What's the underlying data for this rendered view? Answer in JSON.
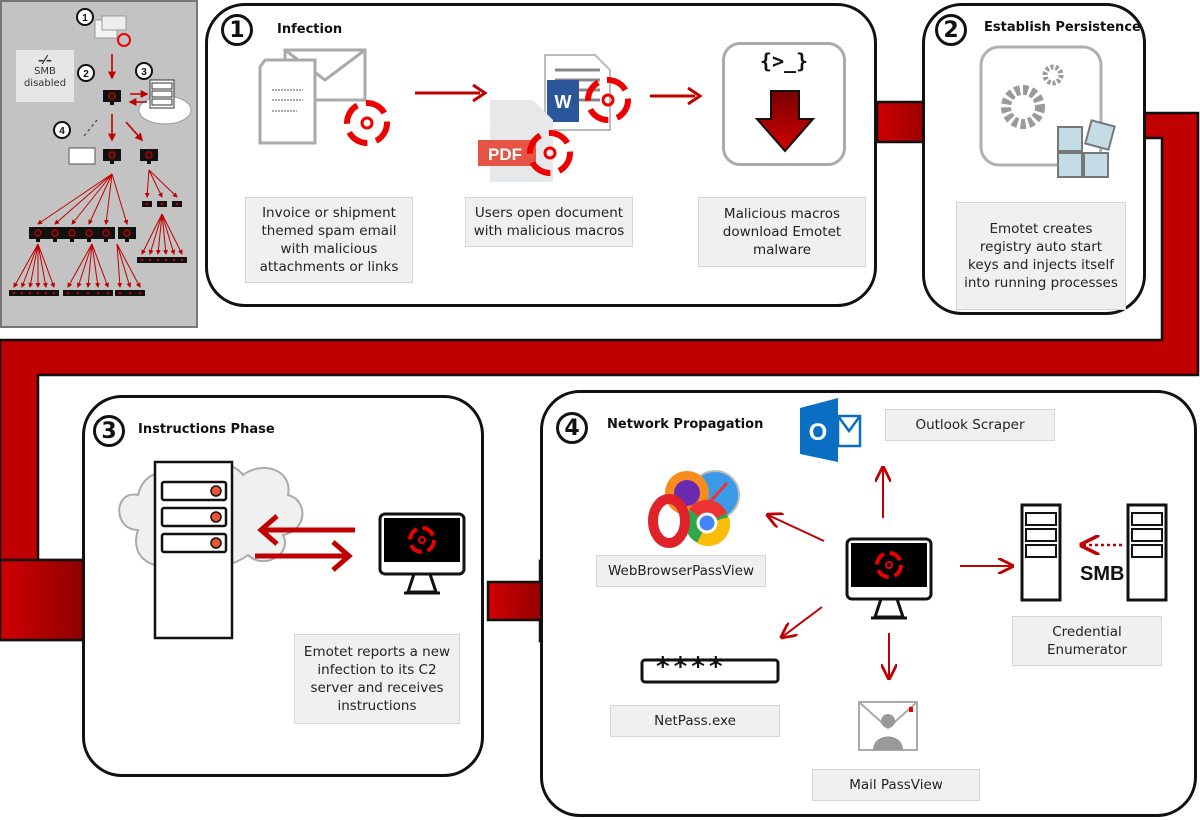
{
  "overview": {
    "smb_status_lines": [
      "SMB",
      "disabled"
    ],
    "step_numbers": [
      "1",
      "2",
      "3",
      "4"
    ]
  },
  "phases": [
    {
      "number": "1",
      "title": "Infection",
      "steps": [
        {
          "icon": "spam-email-icon",
          "label": "Invoice or shipment themed spam email with malicious attachments or links"
        },
        {
          "icon": "infected-documents-icon",
          "label": "Users open document with malicious macros",
          "badges": [
            "W",
            "PDF"
          ]
        },
        {
          "icon": "download-icon",
          "code_glyph": "{>_}",
          "label": "Malicious macros download Emotet malware"
        }
      ]
    },
    {
      "number": "2",
      "title": "Establish Persistence",
      "steps": [
        {
          "icon": "gears-registry-icon",
          "label": "Emotet creates registry auto start keys and injects itself into running processes"
        }
      ]
    },
    {
      "number": "3",
      "title": "Instructions Phase",
      "steps": [
        {
          "icon": "c2-server-icon",
          "label": "Emotet reports a new infection to its C2 server and receives instructions"
        }
      ]
    },
    {
      "number": "4",
      "title": "Network Propagation",
      "modules": [
        {
          "icon": "outlook-icon",
          "label": "Outlook Scraper",
          "badge": "O"
        },
        {
          "icon": "browsers-icon",
          "label": "WebBrowserPassView"
        },
        {
          "icon": "password-field-icon",
          "label": "NetPass.exe",
          "mask": "****"
        },
        {
          "icon": "mail-user-icon",
          "label": "Mail PassView"
        },
        {
          "icon": "servers-icon",
          "label": "Credential Enumerator",
          "protocol": "SMB"
        }
      ]
    }
  ],
  "colors": {
    "accent_red": "#c00000",
    "dark_red": "#7a0000",
    "label_bg": "#f0f0f0",
    "overview_bg": "#c3c3c3"
  }
}
